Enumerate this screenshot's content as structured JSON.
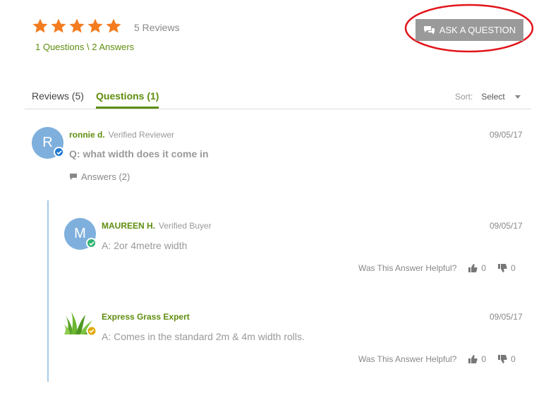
{
  "summary": {
    "rating": 5,
    "rating_max": 5,
    "reviews_label": "5 Reviews",
    "qa_label": "1 Questions \\ 2 Answers",
    "star_color": "#f47c20"
  },
  "ask_button": {
    "label": "ASK A QUESTION",
    "icon": "chat-bubbles-icon"
  },
  "tabs": {
    "reviews": "Reviews (5)",
    "questions": "Questions (1)",
    "sort_label": "Sort:",
    "sort_value": "Select"
  },
  "question": {
    "avatar_initial": "R",
    "author": "ronnie d.",
    "role": "Verified Reviewer",
    "date": "09/05/17",
    "text": "Q: what width does it come in",
    "answers_link": "Answers (2)"
  },
  "answers": [
    {
      "avatar_initial": "M",
      "author": "MAUREEN H.",
      "role": "Verified Buyer",
      "date": "09/05/17",
      "text": "A: 2or 4metre width",
      "helpful_label": "Was This Answer Helpful?",
      "up_count": "0",
      "down_count": "0"
    },
    {
      "author": "Express Grass Expert",
      "date": "09/05/17",
      "text": "A: Comes in the standard 2m & 4m width rolls.",
      "helpful_label": "Was This Answer Helpful?",
      "up_count": "0",
      "down_count": "0"
    }
  ],
  "colors": {
    "brand_green": "#5f8d0e",
    "verified_blue": "#1e78d2",
    "buyer_green": "#2db36f",
    "expert_gold": "#e0a800",
    "highlight_red": "#e2151b"
  }
}
